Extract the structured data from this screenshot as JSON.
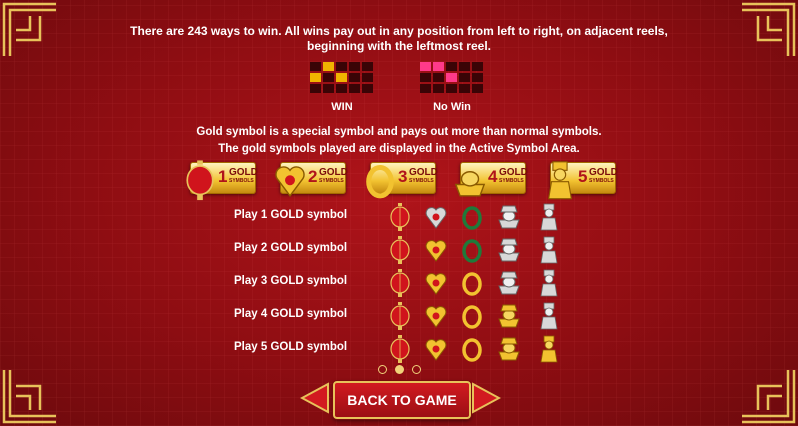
{
  "intro": {
    "line1": "There are 243 ways to win. All wins pay out in any position from left to right, on adjacent reels,",
    "line2": "beginning with the leftmost reel."
  },
  "patterns": {
    "win_label": "WIN",
    "nowin_label": "No Win"
  },
  "gold_info": {
    "line1": "Gold symbol is a special symbol and pays out more than normal symbols.",
    "line2": "The gold symbols played are displayed in the Active Symbol Area."
  },
  "badges": [
    {
      "num": "1",
      "word": "GOLD",
      "sub": "SYMBOLS",
      "icon": "lantern-icon"
    },
    {
      "num": "2",
      "word": "GOLD",
      "sub": "SYMBOLS",
      "icon": "heart-gem-icon"
    },
    {
      "num": "3",
      "word": "GOLD",
      "sub": "SYMBOLS",
      "icon": "ring-icon"
    },
    {
      "num": "4",
      "word": "GOLD",
      "sub": "SYMBOLS",
      "icon": "ingot-icon"
    },
    {
      "num": "5",
      "word": "GOLD",
      "sub": "SYMBOLS",
      "icon": "fortune-god-icon"
    }
  ],
  "rows": [
    {
      "label": "Play 1 GOLD symbol",
      "gold_count": 1
    },
    {
      "label": "Play 2 GOLD symbol",
      "gold_count": 2
    },
    {
      "label": "Play 3 GOLD symbol",
      "gold_count": 3
    },
    {
      "label": "Play 4 GOLD symbol",
      "gold_count": 4
    },
    {
      "label": "Play 5 GOLD symbol",
      "gold_count": 5
    }
  ],
  "symbols": [
    "lantern-icon",
    "heart-gem-icon",
    "ring-icon",
    "ingot-icon",
    "fortune-god-icon"
  ],
  "pagination": {
    "pages": 3,
    "current": 2
  },
  "back_button": {
    "label": "BACK TO GAME"
  },
  "colors": {
    "background": "#8e0d12",
    "gold": "#f2c230",
    "win": "#f0b400",
    "nowin": "#ff3a8a"
  }
}
